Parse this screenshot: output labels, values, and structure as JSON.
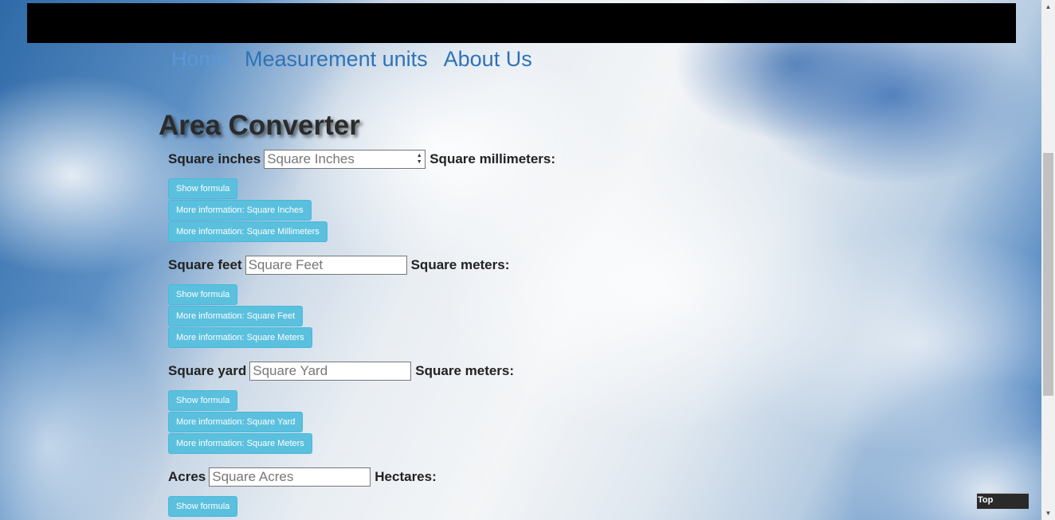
{
  "nav": {
    "items": [
      {
        "label": "Home",
        "active": true
      },
      {
        "label": "Measurement units",
        "active": false
      },
      {
        "label": "About Us",
        "active": false
      }
    ]
  },
  "page_title": "Area Converter",
  "converters": [
    {
      "from_label": "Square inches",
      "placeholder": "Square Inches",
      "value": "",
      "to_label": "Square millimeters:",
      "show_formula": "Show formula",
      "info_buttons": [
        "More information: Square Inches",
        "More information: Square Millimeters"
      ]
    },
    {
      "from_label": "Square feet",
      "placeholder": "Square Feet",
      "value": "",
      "to_label": "Square meters:",
      "show_formula": "Show formula",
      "info_buttons": [
        "More information: Square Feet",
        "More information: Square Meters"
      ]
    },
    {
      "from_label": "Square yard",
      "placeholder": "Square Yard",
      "value": "",
      "to_label": "Square meters:",
      "show_formula": "Show formula",
      "info_buttons": [
        "More information: Square Yard",
        "More information: Square Meters"
      ]
    },
    {
      "from_label": "Acres",
      "placeholder": "Square Acres",
      "value": "",
      "to_label": "Hectares:",
      "show_formula": "Show formula",
      "info_buttons": []
    }
  ],
  "top_button": "Top",
  "colors": {
    "nav_link": "#2f72b7",
    "button_bg": "#5bc0de",
    "topbar": "#000000"
  }
}
